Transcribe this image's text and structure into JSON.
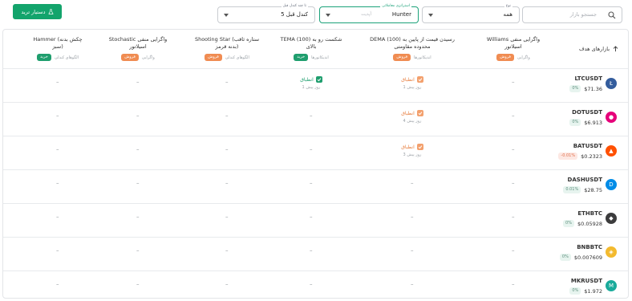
{
  "toolbar": {
    "trade_button": "دستیار ترید",
    "search_placeholder": "جستجو بازار",
    "type_label": "نوع",
    "type_value": "همه",
    "strategy_label": "استراتژی معاملاتی",
    "strategy_value": "Hunter",
    "strategy_hint": "آپدیت",
    "candles_label": "تا چند کندل قبل",
    "candles_value": "5 کندل قبل"
  },
  "table": {
    "targets_header": "بازارهای هدف",
    "columns": [
      {
        "title1": "Williams واگرایی منفی",
        "title2": "اسیلاتور",
        "category": "واگرایی",
        "badge": "فروش",
        "badge_type": "sell"
      },
      {
        "title1": "DEMA (100) رسیدن قیمت از پایین به",
        "title2": "محدوده مقاومتی",
        "category": "اندیکاتورها",
        "badge": "فروش",
        "badge_type": "sell"
      },
      {
        "title1": "TEMA (100) شکست رو به",
        "title2": "بالای",
        "category": "اندیکاتورها",
        "badge": "خرید",
        "badge_type": "buy"
      },
      {
        "title1": "Shooting Star (ستاره ثاقب",
        "title2": "بدنه قرمز)",
        "category": "الگوهای کندلی",
        "badge": "فروش",
        "badge_type": "sell"
      },
      {
        "title1": "Stochastic واگرایی منفی",
        "title2": "اسیلاتور",
        "category": "واگرایی",
        "badge": "فروش",
        "badge_type": "sell"
      },
      {
        "title1": "Hammer (چکش بدنه",
        "title2": "سبز)",
        "category": "الگوهای کندلی",
        "badge": "خرید",
        "badge_type": "buy"
      }
    ],
    "dash": "–",
    "rows": [
      {
        "symbol": "LTCUSDT",
        "price": "$71.36",
        "change": "0%",
        "change_type": "neutral",
        "coin": "ltc-coin-icon",
        "coin_color": "#345d9d",
        "signals": [
          null,
          {
            "label": "انطباق",
            "time": "1 روز پیش",
            "type": "sell"
          },
          {
            "label": "انطباق",
            "time": "1 روز پیش",
            "type": "buy"
          },
          null,
          null,
          null
        ]
      },
      {
        "symbol": "DOTUSDT",
        "price": "$6.913",
        "change": "0%",
        "change_type": "neutral",
        "coin": "dot-coin-icon",
        "coin_color": "#e6007a",
        "signals": [
          null,
          {
            "label": "انطباق",
            "time": "4 روز پیش",
            "type": "sell"
          },
          null,
          null,
          null,
          null
        ]
      },
      {
        "symbol": "BATUSDT",
        "price": "$0.2323",
        "change": "-0.01%",
        "change_type": "neg",
        "coin": "bat-coin-icon",
        "coin_color": "#ff5000",
        "signals": [
          null,
          {
            "label": "انطباق",
            "time": "3 روز پیش",
            "type": "sell"
          },
          null,
          null,
          null,
          null
        ]
      },
      {
        "symbol": "DASHUSDT",
        "price": "$28.75",
        "change": "0.01%",
        "change_type": "neutral",
        "coin": "dash-coin-icon",
        "coin_color": "#008ce7",
        "signals": [
          null,
          null,
          null,
          null,
          null,
          null
        ]
      },
      {
        "symbol": "ETHBTC",
        "price": "$0.05928",
        "change": "0%",
        "change_type": "neutral",
        "coin": "eth-coin-icon",
        "coin_color": "#3c3c3d",
        "signals": [
          null,
          null,
          null,
          null,
          null,
          null
        ]
      },
      {
        "symbol": "BNBBTC",
        "price": "$0.007609",
        "change": "0%",
        "change_type": "neutral",
        "coin": "bnb-coin-icon",
        "coin_color": "#f3ba2f",
        "signals": [
          null,
          null,
          null,
          null,
          null,
          null
        ]
      },
      {
        "symbol": "MKRUSDT",
        "price": "$1.972",
        "change": "0%",
        "change_type": "neutral",
        "coin": "mkr-coin-icon",
        "coin_color": "#1aab9b",
        "signals": [
          null,
          null,
          null,
          null,
          null,
          null
        ]
      }
    ]
  }
}
